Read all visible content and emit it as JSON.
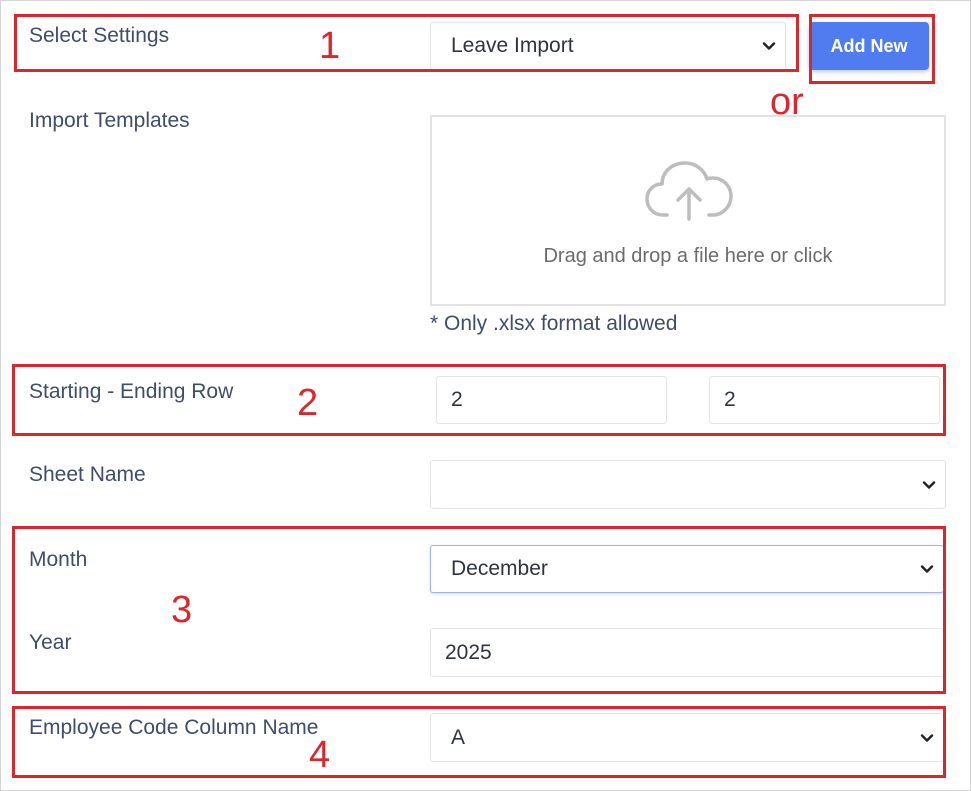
{
  "select_settings": {
    "label": "Select Settings",
    "value": "Leave Import"
  },
  "add_new_label": "Add New",
  "or_label": "or",
  "import_templates": {
    "label": "Import Templates",
    "drop_text": "Drag and drop a file here or click",
    "hint": "* Only .xlsx format allowed",
    "icon": "cloud-upload-icon"
  },
  "rows": {
    "label": "Starting - Ending Row",
    "start": "2",
    "end": "2"
  },
  "sheet_name": {
    "label": "Sheet Name",
    "value": ""
  },
  "month": {
    "label": "Month",
    "value": "December"
  },
  "year": {
    "label": "Year",
    "value": "2025"
  },
  "employee_code": {
    "label": "Employee Code Column Name",
    "value": "A"
  },
  "annotations": [
    "1",
    "2",
    "3",
    "4"
  ],
  "colors": {
    "accent": "#4f7df0",
    "annotation": "#d9272e",
    "label": "#3f4d6b"
  }
}
